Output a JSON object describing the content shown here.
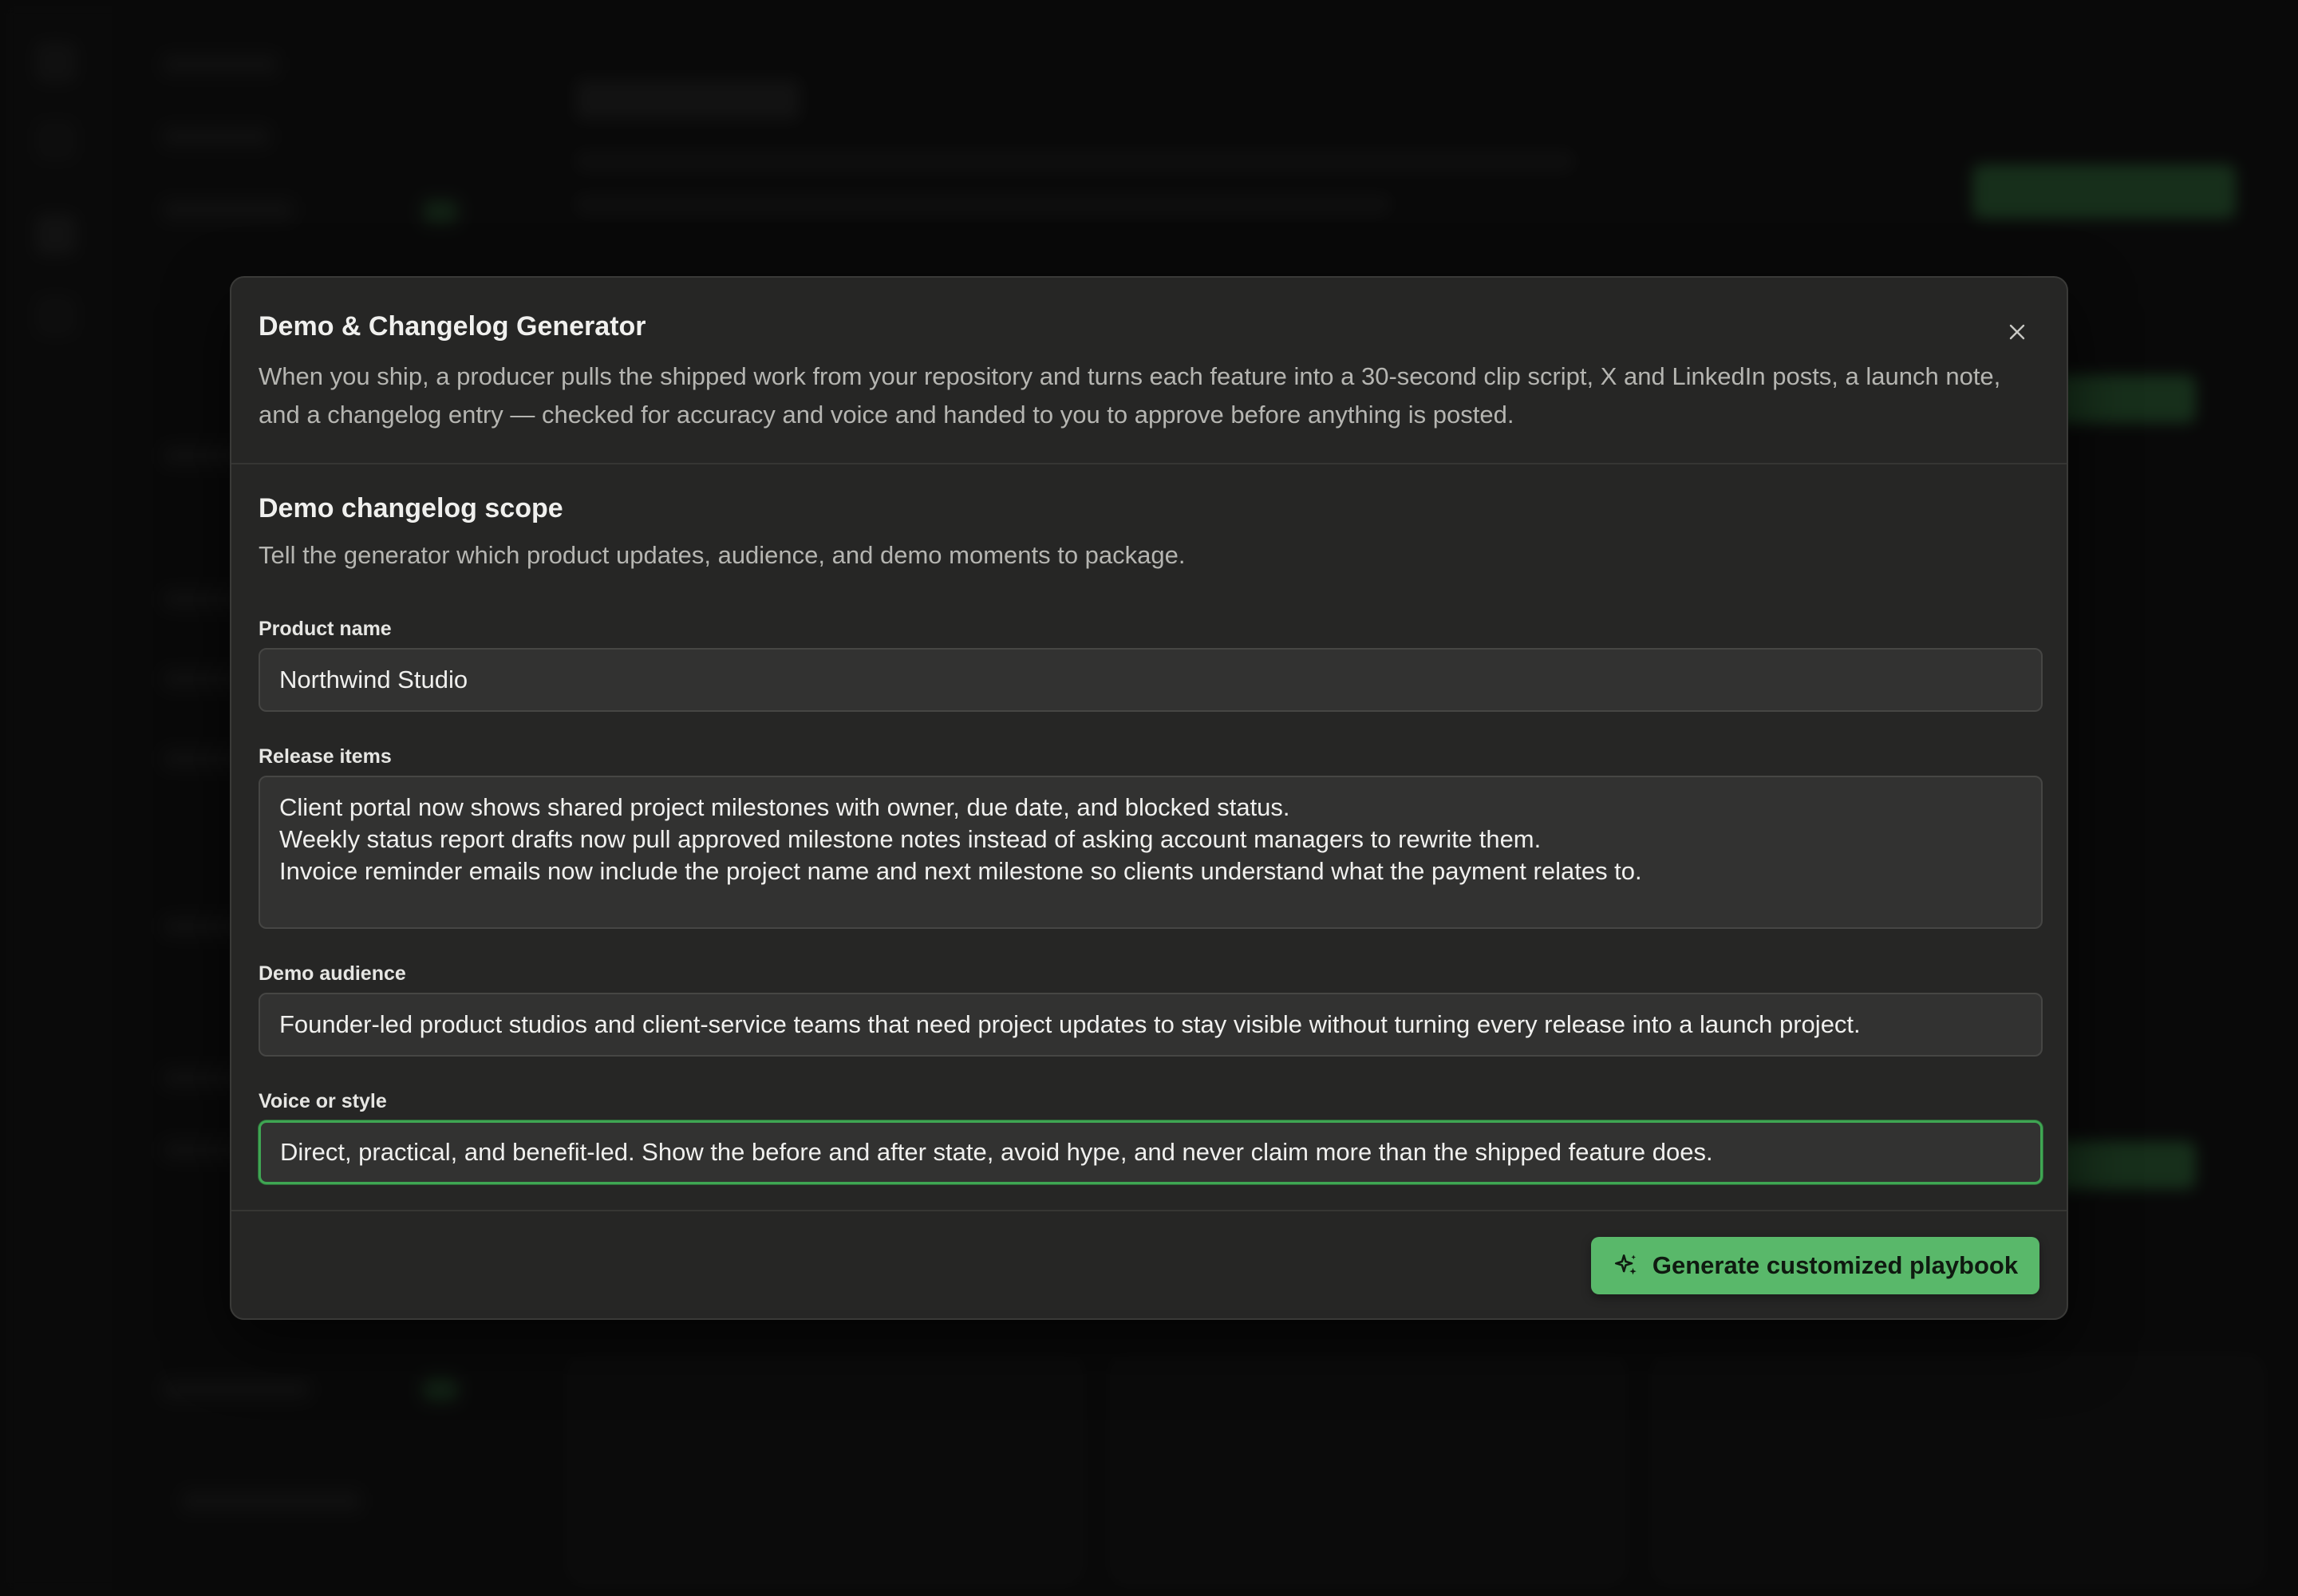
{
  "modal": {
    "title": "Demo & Changelog Generator",
    "description": "When you ship, a producer pulls the shipped work from your repository and turns each feature into a 30-second clip script, X and LinkedIn posts, a launch note, and a changelog entry — checked for accuracy and voice and handed to you to approve before anything is posted.",
    "close_icon": "close-icon"
  },
  "section": {
    "title": "Demo changelog scope",
    "subtitle": "Tell the generator which product updates, audience, and demo moments to package."
  },
  "fields": {
    "product_name": {
      "label": "Product name",
      "value": "Northwind Studio"
    },
    "release_items": {
      "label": "Release items",
      "value": "Client portal now shows shared project milestones with owner, due date, and blocked status.\nWeekly status report drafts now pull approved milestone notes instead of asking account managers to rewrite them.\nInvoice reminder emails now include the project name and next milestone so clients understand what the payment relates to."
    },
    "demo_audience": {
      "label": "Demo audience",
      "value": "Founder-led product studios and client-service teams that need project updates to stay visible without turning every release into a launch project."
    },
    "voice_or_style": {
      "label": "Voice or style",
      "value": "Direct, practical, and benefit-led. Show the before and after state, avoid hype, and never claim more than the shipped feature does."
    }
  },
  "footer": {
    "generate_label": "Generate customized playbook",
    "generate_icon": "sparkles-icon"
  },
  "colors": {
    "accent": "#59b86a",
    "focus_ring": "#3fa653",
    "modal_bg": "#262625",
    "input_bg": "#323231"
  }
}
